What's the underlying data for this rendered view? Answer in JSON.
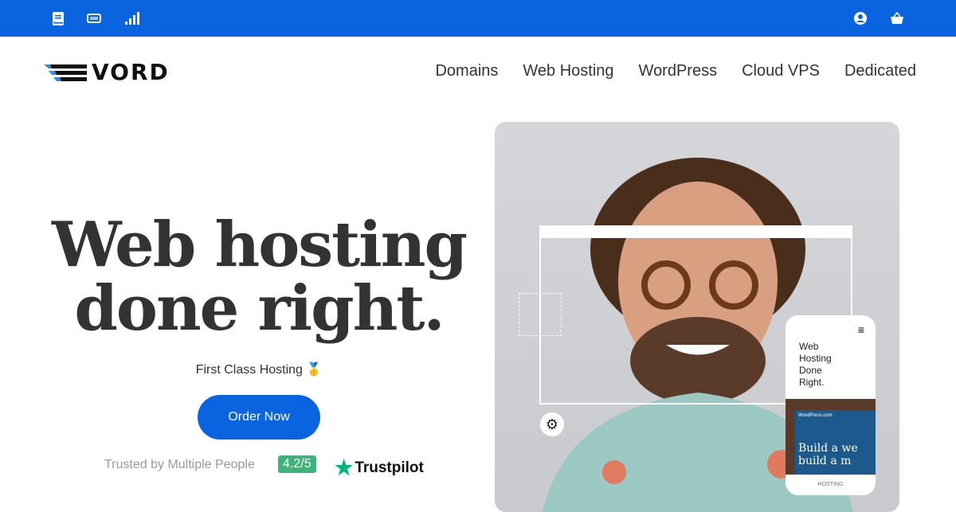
{
  "topbar": {
    "icons": [
      "book-icon",
      "ticket-icon",
      "signal-icon",
      "user-icon",
      "basket-icon"
    ],
    "color": "#0a64e0"
  },
  "brand": {
    "name": "VORD"
  },
  "nav": [
    "Domains",
    "Web Hosting",
    "WordPress",
    "Cloud VPS",
    "Dedicated"
  ],
  "hero": {
    "title_line1": "Web hosting",
    "title_line2": "done right.",
    "subtitle": "First Class Hosting 🥇",
    "cta": "Order Now"
  },
  "trust": {
    "text": "Trusted by Multiple People",
    "rating": "4.2/5",
    "brand": "Trustpilot"
  },
  "mockup": {
    "mobile_title": "Web Hosting Done Right.",
    "screen_text1": "Build a we",
    "screen_text2": "build a m",
    "footer": "HOSTING",
    "site_brand": "WordPress.com"
  }
}
